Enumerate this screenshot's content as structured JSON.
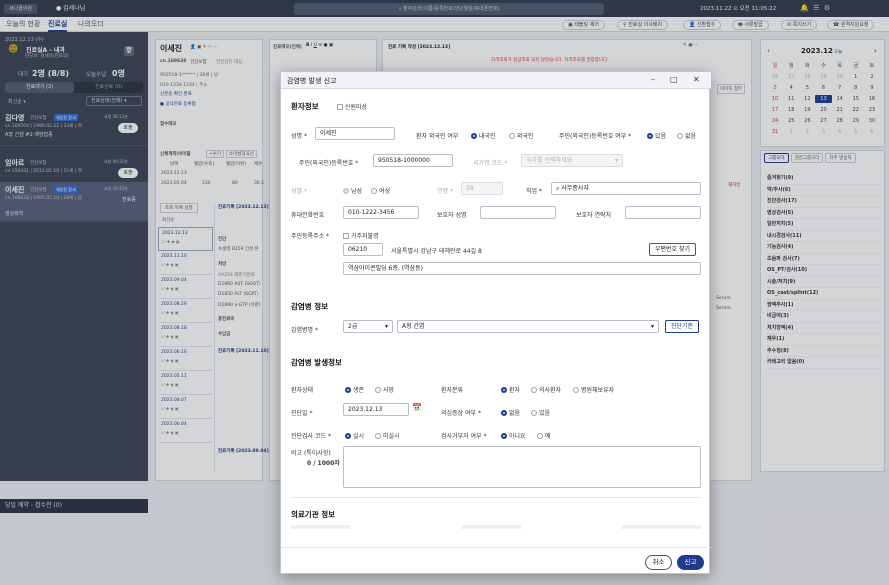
{
  "topbar": {
    "app": "세나클의원",
    "user": "김세나님",
    "search_placeholder": "환자검색(이름/등록번호/생년월일/휴대폰번호)",
    "datetime": "2023.11.22 ⊙ 오전 11:05:22"
  },
  "nav": {
    "tabs": [
      "오늘의 현황",
      "진료실",
      "나의오더"
    ],
    "active": "진료실",
    "buttons": [
      "태블릿 제어",
      "진료실 의사배치",
      "신환접수",
      "서류발급",
      "쪽지쓰기",
      "원격지원요청"
    ]
  },
  "left": {
    "clock": "2023.12.13 (수)",
    "room": "진료실A - 내과",
    "doctor": "담당의: 김세나(진료의)",
    "stats": [
      {
        "label": "대기",
        "value": "2명 (8/8)"
      },
      {
        "label": "오늘수납",
        "value": "0명"
      }
    ],
    "tabs": [
      "진료대기 (3)",
      "진료완료 (0)"
    ],
    "sort": "최신순",
    "status_filter": "진료상태(전체)",
    "patients": [
      {
        "name": "김다영",
        "kind": "건강보험",
        "badge": "재입원 함새",
        "wait": "요청 08:11분",
        "id": "cn.169504 | 1990.02.22 | 33세 | 여",
        "diag": "A형 간염 #2 예방접종",
        "btn": "호출"
      },
      {
        "name": "임아르",
        "kind": "건강보험",
        "badge": "",
        "wait": "요청 09:31분",
        "id": "cn.150431 | 2012.05.10 | 11세 | 여",
        "diag": "",
        "btn": "호출"
      },
      {
        "name": "이세진",
        "kind": "건강보험",
        "badge": "재입원 함새",
        "wait": "요청 10:41분",
        "id": "cn.169628 | 1995.05.18 | 28세 | 남",
        "diag": "영상화학",
        "btn": "진료중"
      }
    ],
    "footer": "당일 예약 - 접수전 (0)"
  },
  "mid": {
    "name": "이세진",
    "id": "cn.169628",
    "ins": "건강보험",
    "ins2": "건강검진 대상",
    "rrn": "950518-1******",
    "age": "28세",
    "gender": "남",
    "phone": "010-1234-1234",
    "addr_label": "주소",
    "link1": "신분증 확인 완료",
    "link2": "공식만료 등록됨",
    "memo_label": "접수메모",
    "vitals_title": "신체계측/바이탈",
    "vitals_btn1": "+수기",
    "vitals_btn2": "소아성장곡선",
    "vital_heads": [
      "날짜",
      "혈압(수축)",
      "혈압(이완)",
      "체온"
    ],
    "vital_rows": [
      [
        "2023.12.13",
        "",
        "",
        ""
      ],
      [
        "2023.05.04",
        "130",
        "80",
        "36.5"
      ]
    ],
    "hist_title": "조회 목록 설정",
    "hist_sort": "최신순",
    "hist_dates": [
      "2023.12.13",
      "2023.11.10",
      "2023.09.04",
      "2023.08.29",
      "2023.08.18",
      "2023.06.16",
      "2023.05.11",
      "2023.08.07",
      "2023.06.04"
    ]
  },
  "records": {
    "rec1": "진료기록 [2023.12.13]",
    "rec2": "진료기록 [2023.11.10]",
    "rec3": "진료기록 [2023.09.04]",
    "items": [
      "수생병 B159 간성 본",
      "AA254 재판기본료",
      "D1860 AST (SGOT)",
      "D1850 ALT (SGPT)",
      "D1890 γ-GTP (유판)"
    ],
    "labels": [
      "진단",
      "처방",
      "총진료비",
      "수납금"
    ]
  },
  "editor": {
    "title": "진료메모(전체)",
    "header": "진료 기록 작성 [2023.12.13]",
    "warning": "자격조회가 정상조회 되지 않았습니다. 자격조회를 권장합니다.",
    "serum": [
      "Serum",
      "Serum"
    ],
    "side_btn": "이미지 첨부",
    "side_text": "재처방"
  },
  "calendar": {
    "title": "2023.12",
    "today_label": "오늘",
    "days": [
      "일",
      "월",
      "화",
      "수",
      "목",
      "금",
      "토"
    ],
    "weeks": [
      [
        "26",
        "27",
        "28",
        "29",
        "30",
        "1",
        "2"
      ],
      [
        "3",
        "4",
        "5",
        "6",
        "7",
        "8",
        "9"
      ],
      [
        "10",
        "11",
        "12",
        "13",
        "14",
        "15",
        "16"
      ],
      [
        "17",
        "18",
        "19",
        "20",
        "21",
        "22",
        "23"
      ],
      [
        "24",
        "25",
        "26",
        "27",
        "28",
        "29",
        "30"
      ],
      [
        "31",
        "1",
        "2",
        "3",
        "4",
        "5",
        "6"
      ]
    ],
    "selected": "13"
  },
  "groups": {
    "tabs": [
      "그룹오더",
      "검진그룹오더",
      "자주 병용처"
    ],
    "items": [
      "즐겨찾기(9)",
      "약/주사(6)",
      "진단검사(17)",
      "영상검사(5)",
      "일반처치(5)",
      "내시경검사(11)",
      "기능검사(4)",
      "조음파 검사(7)",
      "OS_PT/검사(10)",
      "시술/처치(9)",
      "OS_cast/splint(12)",
      "쌍액주사(1)",
      "비급여(3)",
      "처치장액(4)",
      "재우(1)",
      "주수정(8)",
      "카테고리 없음(0)"
    ]
  },
  "modal": {
    "title": "감염병 발생 신고",
    "s1": "환자정보",
    "s2": "감염병 정보",
    "s3": "감염병 발생정보",
    "s4": "의료기관 정보",
    "new_patient": "신원미상",
    "name_label": "성명",
    "name": "이세진",
    "foreign_label": "환자 외국인 여부",
    "opt_domestic": "내국인",
    "opt_foreign": "외국인",
    "resreg_label": "주민(외국인)등록번호 여부",
    "opt_yes": "있음",
    "opt_no": "없음",
    "rrn_label": "주민(외국인)등록번호",
    "rrn": "950518-1000000",
    "nation_label": "국가명 코드",
    "nation_ph": "국가를 선택하세요",
    "gender_label": "성별",
    "opt_male": "남성",
    "opt_female": "여성",
    "age_label": "연령",
    "age": "28",
    "job_label": "직업",
    "job": "사무종사자",
    "phone_label": "휴대전화번호",
    "phone": "010-1222-3456",
    "guardian_label": "보호자 성명",
    "guardian_phone_label": "보호자 연락처",
    "addr_label": "주민등록주소",
    "addr_chk": "거주지불명",
    "zip": "06210",
    "addr1": "서울특별시 강남구 테헤란로 44길 8",
    "addr2": "역삼아이콘빌딩 6층, (역삼동)",
    "zip_btn": "우편번호 찾기",
    "disease_label": "감염병명",
    "grade": "2급",
    "disease": "A형 간염",
    "criteria_btn": "진단기준",
    "status_label": "환자상태",
    "opt_alive": "생존",
    "opt_dead": "사망",
    "class_label": "환자분류",
    "opt_patient": "환자",
    "opt_suspect": "의사환자",
    "opt_carrier": "병원체보유자",
    "diagdate_label": "진단일",
    "diagdate": "2023.12.13",
    "symptom_label": "의심증상 여부",
    "opt_none": "없음",
    "opt_has": "있음",
    "test_label": "진단검사 코드",
    "opt_done": "실시",
    "opt_notdone": "미실시",
    "refuse_label": "검사거부자 여부",
    "opt_no2": "아니요",
    "opt_yes2": "예",
    "note_label": "비고 (특이사항)",
    "note_count": "0 / 1000자",
    "cancel": "취소",
    "report": "신고"
  }
}
